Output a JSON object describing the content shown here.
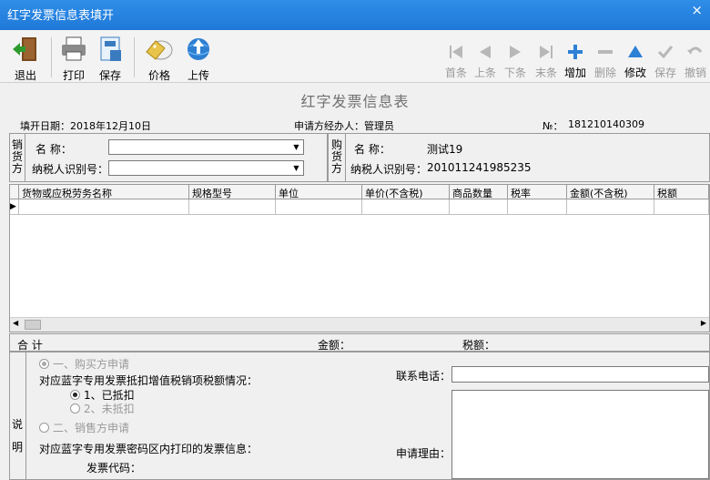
{
  "window": {
    "title": "红字发票信息表填开",
    "close": "×"
  },
  "toolbar_left": [
    {
      "label": "退出",
      "icon": "exit-door-icon"
    },
    {
      "label": "打印",
      "icon": "printer-icon"
    },
    {
      "label": "保存",
      "icon": "save-icon"
    },
    {
      "label": "价格",
      "icon": "price-tag-icon"
    },
    {
      "label": "上传",
      "icon": "upload-globe-icon"
    }
  ],
  "toolbar_right": [
    {
      "label": "首条",
      "icon": "first-record-icon",
      "enabled": false
    },
    {
      "label": "上条",
      "icon": "prev-record-icon",
      "enabled": false
    },
    {
      "label": "下条",
      "icon": "next-record-icon",
      "enabled": false
    },
    {
      "label": "末条",
      "icon": "last-record-icon",
      "enabled": false
    },
    {
      "label": "增加",
      "icon": "add-icon",
      "enabled": true
    },
    {
      "label": "删除",
      "icon": "delete-icon",
      "enabled": false
    },
    {
      "label": "修改",
      "icon": "edit-icon",
      "enabled": true
    },
    {
      "label": "保存",
      "icon": "check-save-icon",
      "enabled": false
    },
    {
      "label": "撤销",
      "icon": "undo-icon",
      "enabled": false
    }
  ],
  "form": {
    "title": "红字发票信息表",
    "fill_date": "填开日期：2018年12月10日",
    "applicant": "申请方经办人：管理员",
    "number_label": "№：",
    "number": "181210140309"
  },
  "seller": {
    "side_label": [
      "销",
      "货",
      "方"
    ],
    "name_label": "名        称：",
    "name_value": "",
    "taxid_label": "纳税人识别号：",
    "taxid_value": ""
  },
  "buyer": {
    "side_label": [
      "购",
      "货",
      "方"
    ],
    "name_label": "名        称：",
    "name_value": "测试19",
    "taxid_label": "纳税人识别号：",
    "taxid_value": "201011241985235"
  },
  "grid": {
    "columns": [
      "货物或应税劳务名称",
      "规格型号",
      "单位",
      "单价(不含税)",
      "商品数量",
      "税率",
      "金额(不含税)",
      "税额"
    ],
    "rows": [
      [
        "",
        "",
        "",
        "",
        "",
        "",
        "",
        ""
      ]
    ]
  },
  "totals": {
    "heji": "合        计",
    "amount_label": "金额：",
    "tax_label": "税额："
  },
  "note": {
    "side_label": [
      "说",
      "明"
    ],
    "buyer_apply": "一、购买方申请",
    "deduct_question": "对应蓝字专用发票抵扣增值税销项税额情况：",
    "opt_deducted": "1、已抵扣",
    "opt_not_deducted": "2、未抵扣",
    "seller_apply": "二、销售方申请",
    "printed_info": "对应蓝字专用发票密码区内打印的发票信息：",
    "invoice_code": "发票代码：",
    "phone_label": "联系电话：",
    "phone_value": "",
    "reason_label": "申请理由：",
    "reason_value": ""
  }
}
